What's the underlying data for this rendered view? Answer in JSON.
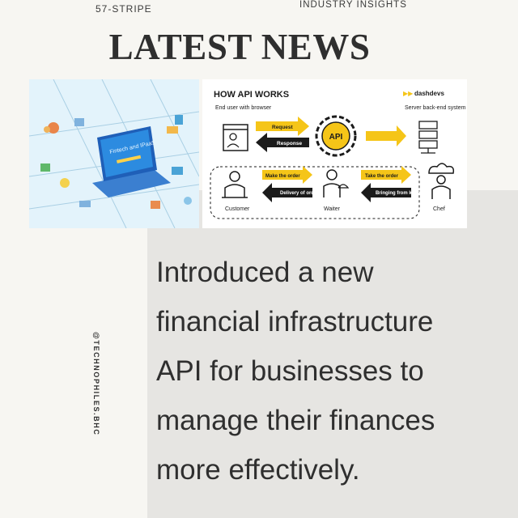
{
  "header": {
    "source_label": "57-STRIPE",
    "category_label": "INDUSTRY INSIGHTS",
    "headline": "LATEST NEWS"
  },
  "left_image": {
    "screen_text": "Fintech and IPaaS"
  },
  "diagram": {
    "title": "HOW API WORKS",
    "brand": "dashdevs",
    "end_user_label": "End user with browser",
    "server_label": "Server back-end system",
    "request_label": "Request",
    "response_label": "Response",
    "api_label": "API",
    "make_order_label": "Make the order",
    "delivery_label": "Delivery of order",
    "take_order_label": "Take the order",
    "bringing_label": "Bringing from kitchen",
    "customer_label": "Customer",
    "waiter_label": "Waiter",
    "chef_label": "Chef",
    "accent_color": "#f5c518"
  },
  "sidebar": {
    "handle": "@TECHNOPHILES.BHC"
  },
  "body": {
    "lines": [
      "Introduced a new",
      "financial infrastructure",
      "API for businesses to",
      "manage their finances",
      "more effectively."
    ]
  }
}
